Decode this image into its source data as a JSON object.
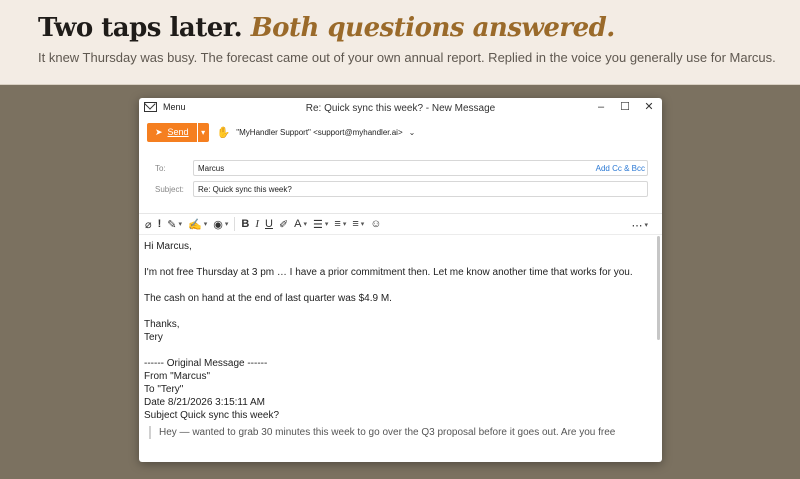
{
  "hero": {
    "headline_plain": "Two taps later.",
    "headline_accent": "Both questions answered.",
    "subline": "It knew Thursday was busy. The forecast came out of your own annual report. Replied in the voice you generally use for Marcus."
  },
  "window": {
    "menu_label": "Menu",
    "title": "Re: Quick sync this week? - New Message",
    "controls": [
      "–",
      "☐",
      "✕"
    ]
  },
  "compose": {
    "send_label": "Send",
    "from": "\"MyHandler Support\" <support@myhandler.ai>",
    "to_label": "To:",
    "to_value": "Marcus",
    "add_cc": "Add Cc & Bcc",
    "subject_label": "Subject:",
    "subject_value": "Re: Quick sync this week?"
  },
  "toolbar": {
    "icons": [
      "paperclip-icon",
      "importance-icon",
      "highlighter-icon",
      "signature-icon",
      "view-icon",
      "bold-icon",
      "italic-icon",
      "underline-icon",
      "format-painter-icon",
      "font-color-icon",
      "bullet-list-icon",
      "numbered-list-icon",
      "align-icon",
      "emoji-icon",
      "more-options-icon"
    ]
  },
  "body": {
    "greeting": "Hi Marcus,",
    "line1": "I'm not free Thursday at 3 pm … I have a prior commitment then.  Let me know another time that works for you.",
    "line2": "The cash on hand at the end of last quarter was $4.9 M.",
    "signoff": "Thanks,",
    "signature": "Tery",
    "orig_header": "------ Original Message ------",
    "orig_from": "From \"Marcus\"",
    "orig_to": "To \"Tery\"",
    "orig_date": "Date 8/21/2026 3:15:11 AM",
    "orig_subject": "Subject Quick sync this week?",
    "quote": "Hey — wanted to grab 30 minutes this week to go over the Q3 proposal before it goes out.  Are you free"
  }
}
